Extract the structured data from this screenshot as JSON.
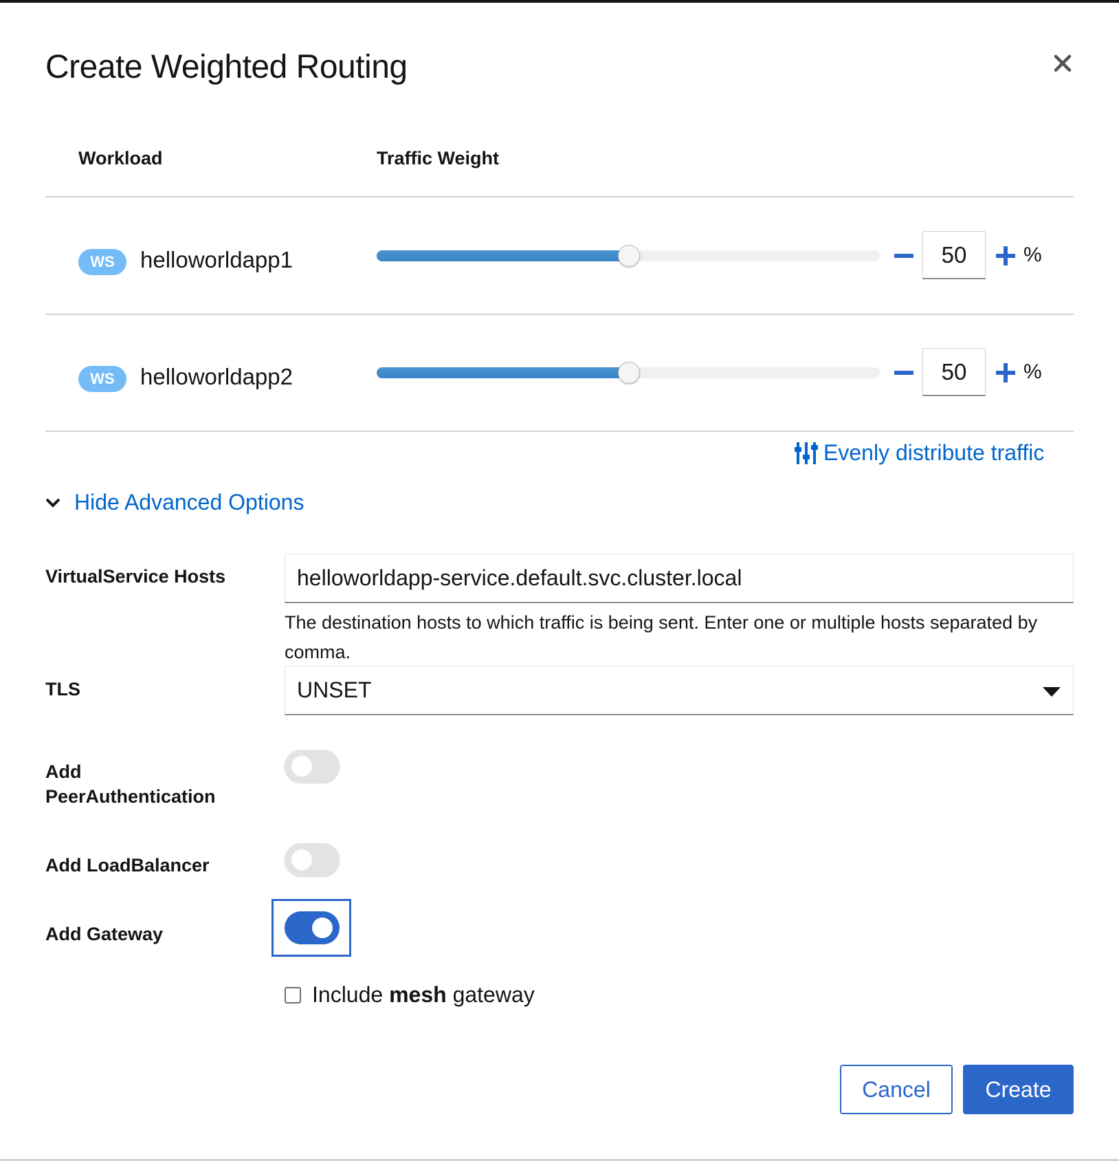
{
  "modal": {
    "title": "Create Weighted Routing"
  },
  "table": {
    "headers": {
      "workload": "Workload",
      "traffic_weight": "Traffic Weight"
    },
    "rows": [
      {
        "badge": "WS",
        "name": "helloworldapp1",
        "weight": "50",
        "weight_fraction": 0.5,
        "unit": "%"
      },
      {
        "badge": "WS",
        "name": "helloworldapp2",
        "weight": "50",
        "weight_fraction": 0.5,
        "unit": "%"
      }
    ]
  },
  "actions": {
    "even_distribute": "Evenly distribute traffic",
    "advanced_toggle": "Hide Advanced Options"
  },
  "advanced": {
    "vs_hosts_label": "VirtualService Hosts",
    "vs_hosts_value": "helloworldapp-service.default.svc.cluster.local",
    "vs_hosts_helper": "The destination hosts to which traffic is being sent. Enter one or multiple hosts separated by comma.",
    "tls_label": "TLS",
    "tls_value": "UNSET",
    "peer_auth_label_line1": "Add",
    "peer_auth_label_line2": "PeerAuthentication",
    "peer_auth_on": false,
    "load_balancer_label": "Add LoadBalancer",
    "load_balancer_on": false,
    "gateway_label": "Add Gateway",
    "gateway_on": true,
    "mesh_prefix": "Include ",
    "mesh_bold": "mesh",
    "mesh_suffix": " gateway",
    "mesh_checked": false
  },
  "footer": {
    "cancel_label": "Cancel",
    "create_label": "Create"
  },
  "colors": {
    "primary": "#2b66c9",
    "link": "#0066cc",
    "badge": "#73bcf7",
    "slider_fill": "#3a84c7"
  }
}
